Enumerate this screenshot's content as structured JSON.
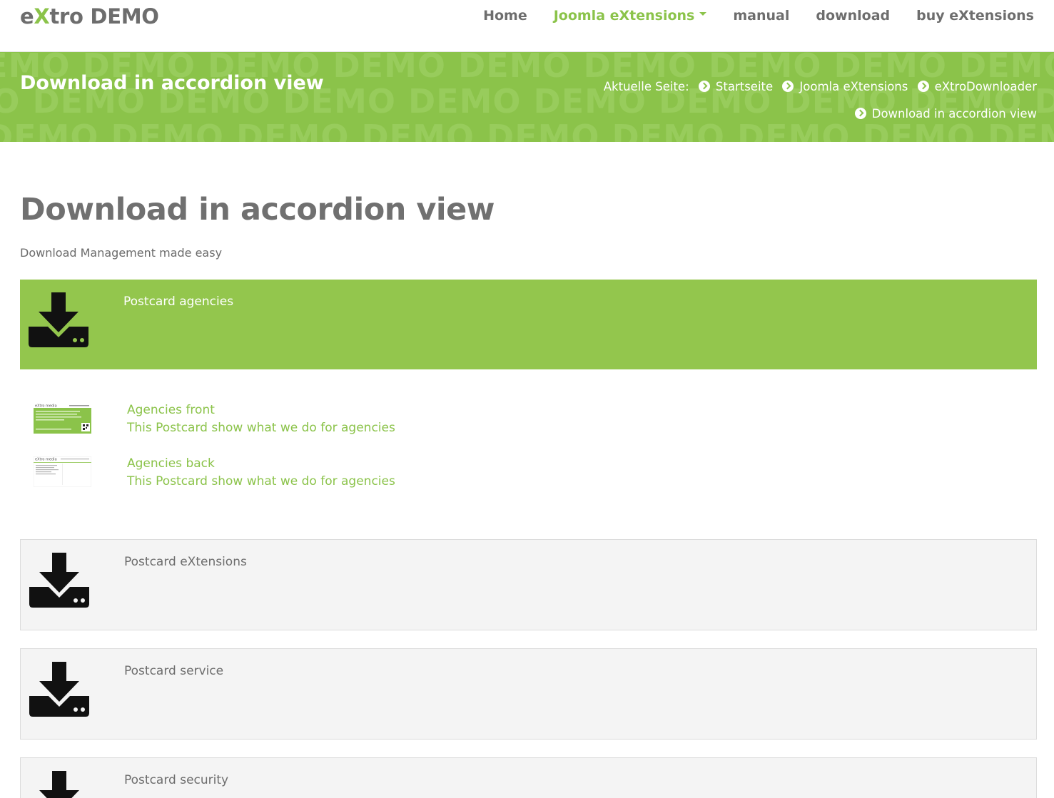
{
  "brand": {
    "prefix": "e",
    "x": "X",
    "suffix": "tro DEMO"
  },
  "nav": {
    "items": [
      {
        "label": "Home"
      },
      {
        "label": "Joomla eXtensions"
      },
      {
        "label": "manual"
      },
      {
        "label": "download"
      },
      {
        "label": "buy eXtensions"
      }
    ]
  },
  "banner": {
    "title": "Download in accordion view",
    "watermark_word": "DEMO",
    "breadcrumb_label": "Aktuelle Seite:",
    "breadcrumb": [
      "Startseite",
      "Joomla eXtensions",
      "eXtroDownloader",
      "Download in accordion view"
    ]
  },
  "page": {
    "title": "Download in accordion view",
    "subtitle": "Download Management made easy"
  },
  "accordions": [
    {
      "title": "Postcard agencies",
      "state": "open",
      "files": [
        {
          "name": "Agencies front",
          "description": "This Postcard show what we do for agencies"
        },
        {
          "name": "Agencies back",
          "description": "This Postcard show what we do for agencies"
        }
      ]
    },
    {
      "title": "Postcard eXtensions",
      "state": "closed"
    },
    {
      "title": "Postcard service",
      "state": "closed"
    },
    {
      "title": "Postcard security",
      "state": "closed"
    }
  ],
  "thumbnails": [
    {
      "brand_text": "eXtro media"
    },
    {
      "brand_text": "eXtro media"
    }
  ],
  "colors": {
    "accent": "#8bc34a",
    "text": "#6b6b6b",
    "closed_bg": "#f4f4f4"
  },
  "icons": {
    "download": "download-tray-icon",
    "breadcrumb_separator": "chevron-circle-right-icon",
    "dropdown": "caret-down-icon"
  }
}
